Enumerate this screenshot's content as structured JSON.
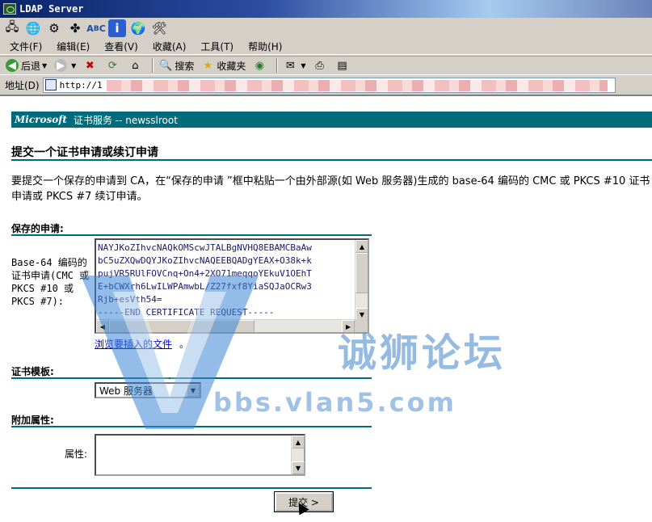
{
  "window": {
    "title": "LDAP Server"
  },
  "icon_toolbar": [
    "network-icon",
    "globe-icon",
    "globe-settings-icon",
    "pinwheel-icon",
    "abc-icon",
    "info-icon",
    "globe-green-icon",
    "tools-icon"
  ],
  "menu": [
    "文件(F)",
    "编辑(E)",
    "查看(V)",
    "收藏(A)",
    "工具(T)",
    "帮助(H)"
  ],
  "nav": {
    "back": "后退",
    "search": "搜索",
    "favorites": "收藏夹"
  },
  "address": {
    "label": "地址(D)",
    "url": "http://1"
  },
  "page": {
    "brand": "Microsoft",
    "header": "证书服务  --  newsslroot",
    "title": "提交一个证书申请或续订申请",
    "desc": "要提交一个保存的申请到 CA，在“保存的申请 ”框中粘贴一个由外部源(如 Web 服务器)生成的 base-64 编码的 CMC 或 PKCS #10 证书申请或 PKCS #7 续订申请。",
    "saved_request_label": "保存的申请:",
    "field_label": "Base-64 编码的证书申请(CMC 或 PKCS #10 或 PKCS #7):",
    "request_text": "NAYJKoZIhvcNAQkOMScwJTALBgNVHQ8EBAMCBaAw\nbC5uZXQwDQYJKoZIhvcNAQEEBQADgYEAX+O38k+k\npujVR5RUlFOVCnq+On4+2XO71meqqoYEkuV1OEhT\nE+bCWXrh6LwILWPAmwbL/Z27fxf8YiaSQJaOCRw3\nRjb+esVth54=\n-----END CERTIFICATE REQUEST-----",
    "browse_link": "浏览要插入的文件",
    "browse_suffix": "。",
    "template_label": "证书模板:",
    "template_value": "Web 服务器",
    "extra_attr_label": "附加属性:",
    "attr_field_label": "属性:",
    "submit_label": "提交 >"
  },
  "watermark": {
    "text": "诚狮论坛",
    "url": "bbs.vlan5.com"
  },
  "colors": {
    "teal": "#006b7b",
    "link": "#0000cc",
    "watermark": "#2f79c9"
  }
}
